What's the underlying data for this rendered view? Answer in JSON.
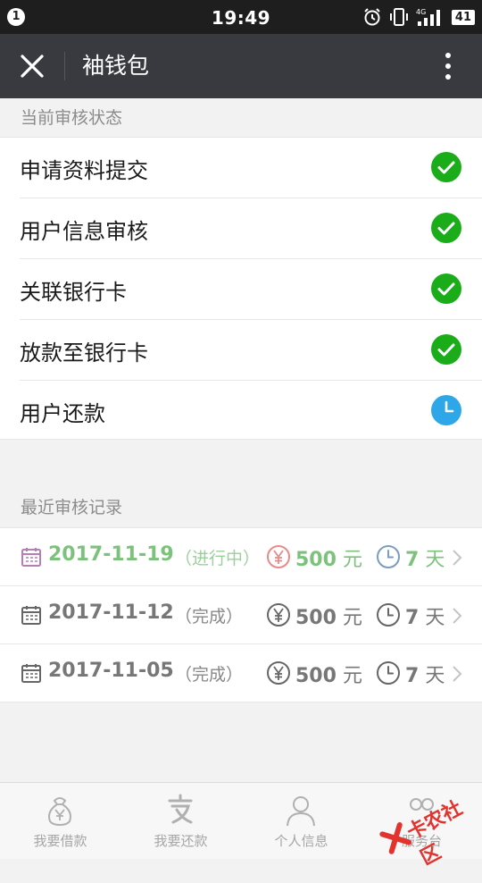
{
  "status_bar": {
    "notification_count": "1",
    "time": "19:49",
    "network": "4G",
    "battery": "41",
    "icons": [
      "alarm-icon",
      "vibrate-icon",
      "signal-icon"
    ]
  },
  "title_bar": {
    "title": "袖钱包",
    "close_icon": "close-icon",
    "more_icon": "more-vertical-icon"
  },
  "audit_status": {
    "section_title": "当前审核状态",
    "steps": [
      {
        "label": "申请资料提交",
        "state": "done"
      },
      {
        "label": "用户信息审核",
        "state": "done"
      },
      {
        "label": "关联银行卡",
        "state": "done"
      },
      {
        "label": "放款至银行卡",
        "state": "done"
      },
      {
        "label": "用户还款",
        "state": "pending"
      }
    ]
  },
  "records": {
    "section_title": "最近审核记录",
    "items": [
      {
        "date": "2017-11-19",
        "status": "（进行中）",
        "amount": "500",
        "amount_unit": "元",
        "days": "7",
        "days_unit": "天",
        "active": true
      },
      {
        "date": "2017-11-12",
        "status": "（完成）",
        "amount": "500",
        "amount_unit": "元",
        "days": "7",
        "days_unit": "天",
        "active": false
      },
      {
        "date": "2017-11-05",
        "status": "（完成）",
        "amount": "500",
        "amount_unit": "元",
        "days": "7",
        "days_unit": "天",
        "active": false
      }
    ]
  },
  "tab_bar": {
    "tabs": [
      {
        "label": "我要借款",
        "icon": "money-bag-icon"
      },
      {
        "label": "我要还款",
        "icon": "alipay-icon"
      },
      {
        "label": "个人信息",
        "icon": "person-icon"
      },
      {
        "label": "服务台",
        "icon": "service-icon"
      }
    ]
  },
  "watermark": {
    "text": "卡农社区"
  },
  "colors": {
    "status_bar": "#1e1e1e",
    "title_bar": "#393a3f",
    "done_green": "#1aad19",
    "pending_blue": "#2ea7e8",
    "active_green": "#7cc27c"
  }
}
